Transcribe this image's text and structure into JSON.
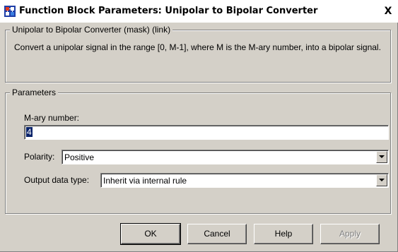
{
  "window": {
    "title": "Function Block Parameters: Unipolar to Bipolar Converter",
    "close_label": "X"
  },
  "mask_group": {
    "legend": "Unipolar to Bipolar Converter (mask) (link)",
    "description": "Convert a unipolar signal in the range [0, M-1], where M is the M-ary number,  into a bipolar signal."
  },
  "parameters_group": {
    "legend": "Parameters",
    "mary_label": "M-ary number:",
    "mary_value": "4",
    "polarity_label": "Polarity:",
    "polarity_value": "Positive",
    "output_type_label": "Output data type:",
    "output_type_value": "Inherit via internal rule"
  },
  "buttons": {
    "ok": "OK",
    "cancel": "Cancel",
    "help": "Help",
    "apply": "Apply"
  },
  "colors": {
    "face": "#d4d0c8",
    "selection": "#0a246a",
    "titlebar": "#ffffff"
  }
}
